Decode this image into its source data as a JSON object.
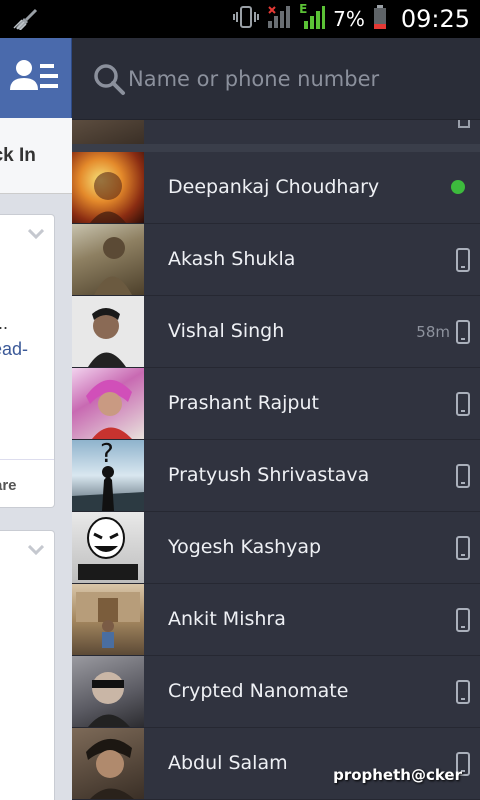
{
  "status_bar": {
    "battery_percent": "7%",
    "time": "09:25",
    "network_type": "E",
    "icons": [
      "broom-icon",
      "vibrate-icon",
      "signal-bars-icon",
      "battery-icon"
    ]
  },
  "background_page": {
    "check_in_label": "eck In",
    "card_text_ellipsis": "..",
    "card_link": "ead-",
    "share_label": "are"
  },
  "chat": {
    "search_placeholder": "Name or phone number",
    "friends": [
      {
        "name": "Deepankaj Choudhary",
        "status": "online",
        "last_seen": ""
      },
      {
        "name": "Akash Shukla",
        "status": "mobile",
        "last_seen": ""
      },
      {
        "name": "Vishal Singh",
        "status": "mobile",
        "last_seen": "58m"
      },
      {
        "name": "Prashant Rajput",
        "status": "mobile",
        "last_seen": ""
      },
      {
        "name": "Pratyush Shrivastava",
        "status": "mobile",
        "last_seen": ""
      },
      {
        "name": "Yogesh Kashyap",
        "status": "mobile",
        "last_seen": ""
      },
      {
        "name": "Ankit Mishra",
        "status": "mobile",
        "last_seen": ""
      },
      {
        "name": "Crypted Nanomate",
        "status": "mobile",
        "last_seen": ""
      },
      {
        "name": "Abdul Salam",
        "status": "mobile",
        "last_seen": ""
      }
    ]
  },
  "watermark": "propheth@cker",
  "colors": {
    "panel_bg": "#30333f",
    "fb_blue": "#3b5a98",
    "online_green": "#3dbb3d"
  }
}
